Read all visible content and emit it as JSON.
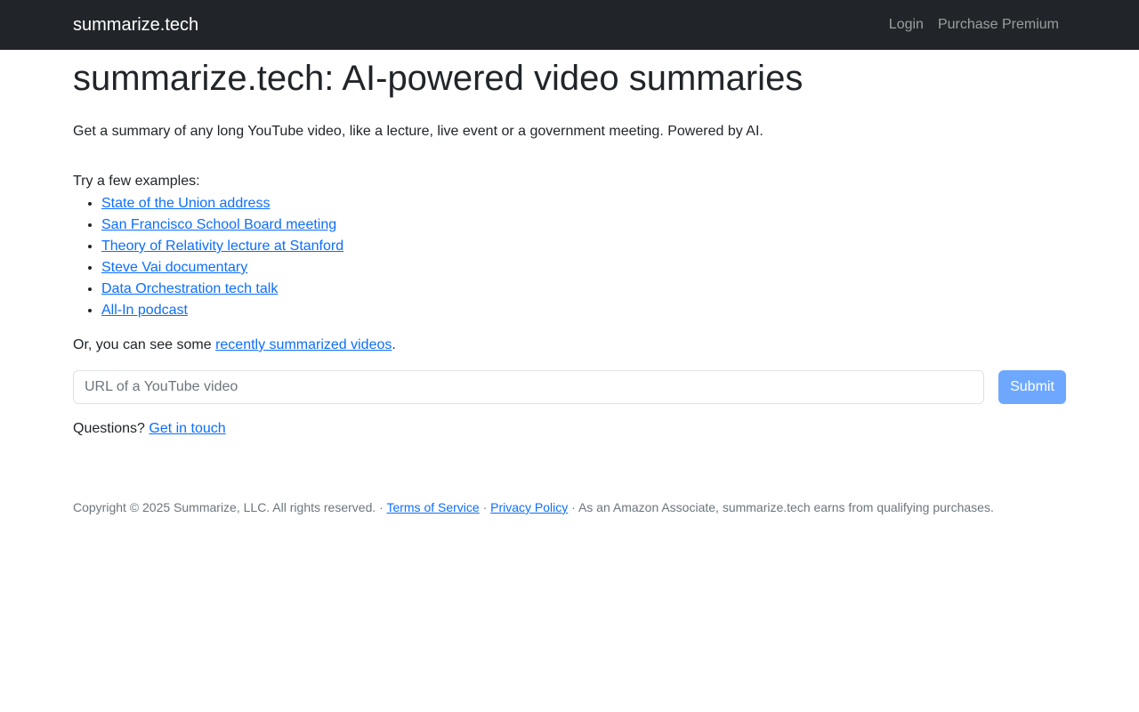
{
  "navbar": {
    "brand": "summarize.tech",
    "links": [
      "Login",
      "Purchase Premium"
    ]
  },
  "main": {
    "title": "summarize.tech: AI-powered video summaries",
    "lead": "Get a summary of any long YouTube video, like a lecture, live event or a government meeting. Powered by AI.",
    "examples_intro": "Try a few examples:",
    "examples": [
      "State of the Union address",
      "San Francisco School Board meeting",
      "Theory of Relativity lecture at Stanford",
      "Steve Vai documentary",
      "Data Orchestration tech talk",
      "All-In podcast"
    ],
    "recent_prefix": "Or, you can see some ",
    "recent_link": "recently summarized videos",
    "recent_suffix": ".",
    "url_placeholder": "URL of a YouTube video",
    "submit_label": "Submit",
    "questions_prefix": "Questions? ",
    "contact_link": "Get in touch"
  },
  "footer": {
    "copyright": "Copyright © 2025 Summarize, LLC. All rights reserved. · ",
    "terms": "Terms of Service",
    "sep": " · ",
    "privacy": "Privacy Policy",
    "amazon": " · As an Amazon Associate, summarize.tech earns from qualifying purchases."
  },
  "colors": {
    "navbar_bg": "#212529",
    "link": "#0d6efd",
    "button_bg": "#6ea8fe"
  }
}
